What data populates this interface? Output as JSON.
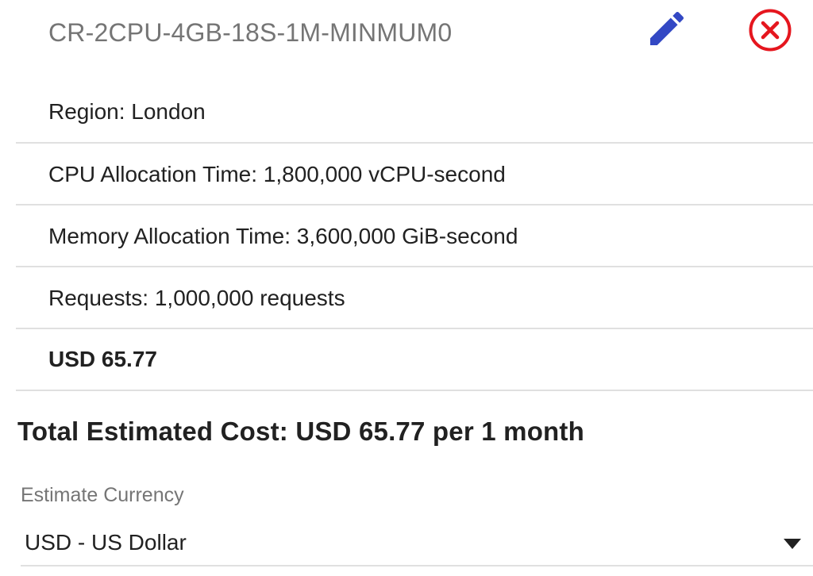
{
  "estimate_item": {
    "title": "CR-2CPU-4GB-18S-1M-MINMUM0",
    "edit_icon": "pencil-icon",
    "remove_icon": "close-circle-icon",
    "details": [
      {
        "label": "Region: London"
      },
      {
        "label": "CPU Allocation Time: 1,800,000 vCPU-second"
      },
      {
        "label": "Memory Allocation Time: 3,600,000 GiB-second"
      },
      {
        "label": "Requests: 1,000,000 requests"
      }
    ],
    "cost": "USD 65.77"
  },
  "total": {
    "text": "Total Estimated Cost: USD 65.77 per 1 month"
  },
  "currency": {
    "label": "Estimate Currency",
    "selected": "USD - US Dollar",
    "arrow_icon": "dropdown-arrow-icon"
  },
  "colors": {
    "edit_icon": "#3348c4",
    "remove_icon": "#e5161e",
    "divider": "#e0e0e0",
    "muted_text": "#757575",
    "text": "#212121"
  }
}
